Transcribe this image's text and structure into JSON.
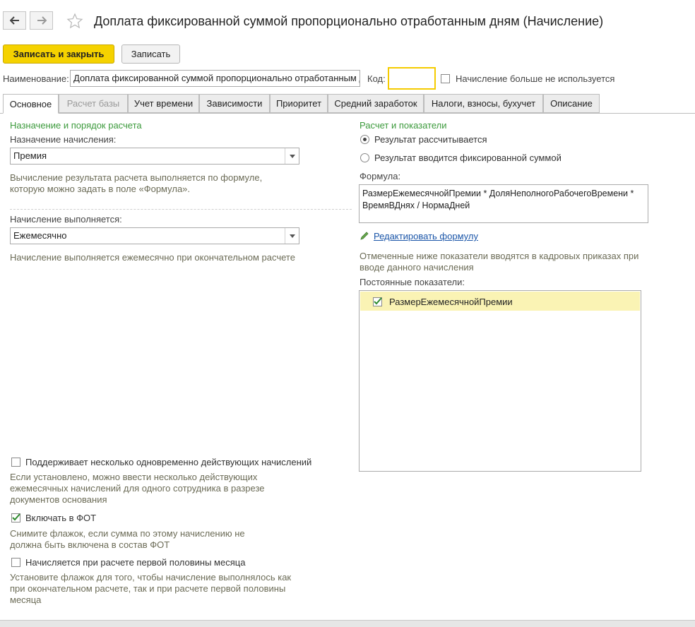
{
  "window": {
    "title": "Доплата фиксированной суммой пропорционально отработанным дням (Начисление)"
  },
  "toolbar": {
    "save_close_label": "Записать и закрыть",
    "save_label": "Записать"
  },
  "header": {
    "name_label": "Наименование:",
    "name_value": "Доплата фиксированной суммой пропорционально отработанным д",
    "code_label": "Код:",
    "code_value": "",
    "not_used_label": "Начисление больше не используется"
  },
  "tabs": [
    {
      "label": "Основное",
      "active": true
    },
    {
      "label": "Расчет базы",
      "disabled": true
    },
    {
      "label": "Учет времени"
    },
    {
      "label": "Зависимости"
    },
    {
      "label": "Приоритет"
    },
    {
      "label": "Средний заработок"
    },
    {
      "label": "Налоги, взносы, бухучет"
    },
    {
      "label": "Описание"
    }
  ],
  "left": {
    "section_title": "Назначение и порядок расчета",
    "purpose_label": "Назначение начисления:",
    "purpose_value": "Премия",
    "purpose_hint": "Вычисление результата расчета выполняется по формуле, которую можно задать в поле «Формула».",
    "period_label": "Начисление выполняется:",
    "period_value": "Ежемесячно",
    "period_hint": "Начисление выполняется ежемесячно при окончательном расчете",
    "multi_label": "Поддерживает несколько одновременно действующих начислений",
    "multi_hint": "Если установлено, можно ввести несколько действующих ежемесячных начислений для одного сотрудника в разрезе документов основания",
    "fot_label": "Включать в ФОТ",
    "fot_hint": "Снимите флажок, если сумма по этому начислению не должна быть включена в состав ФОТ",
    "half_label": "Начисляется при расчете первой половины месяца",
    "half_hint": "Установите флажок для того, чтобы начисление выполнялось как при окончательном расчете, так и при расчете первой половины месяца"
  },
  "right": {
    "section_title": "Расчет и показатели",
    "radio_calc_label": "Результат рассчитывается",
    "radio_fixed_label": "Результат вводится фиксированной суммой",
    "formula_label": "Формула:",
    "formula_value": "РазмерЕжемесячнойПремии * ДоляНеполногоРабочегоВремени * ВремяВДнях / НормаДней",
    "edit_formula_label": "Редактировать формулу",
    "indicators_hint": "Отмеченные ниже показатели вводятся в кадровых приказах при вводе данного начисления",
    "constant_label": "Постоянные показатели:",
    "indicators": [
      {
        "name": "РазмерЕжемесячнойПремии",
        "checked": true
      }
    ]
  },
  "colors": {
    "accent_yellow": "#f5d200",
    "section_green": "#3c9a3c",
    "link_blue": "#1a55a8",
    "selected_row": "#faf3b4"
  }
}
